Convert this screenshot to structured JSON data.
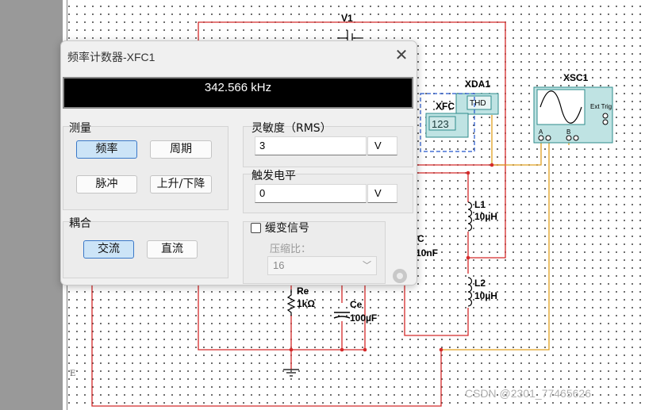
{
  "colors": {
    "wire_red": "#d42a2a",
    "wire_orange": "#e0a020",
    "selection_blue": "#2255cc",
    "instrument_teal": "#2e8b8b"
  },
  "dialog": {
    "title": "频率计数器-XFC1",
    "close_icon": "close-icon",
    "display_value": "342.566 kHz",
    "measure": {
      "label": "测量",
      "buttons": {
        "frequency": "频率",
        "period": "周期",
        "pulse": "脉冲",
        "rise_fall": "上升/下降"
      },
      "active": "frequency"
    },
    "coupling": {
      "label": "耦合",
      "buttons": {
        "ac": "交流",
        "dc": "直流"
      },
      "active": "ac"
    },
    "sensitivity": {
      "label": "灵敏度（RMS）",
      "value": "3",
      "unit": "V"
    },
    "trigger": {
      "label": "触发电平",
      "value": "0",
      "unit": "V"
    },
    "gradual": {
      "label": "缓变信号",
      "checked": false
    },
    "compression": {
      "label": "压缩比：",
      "value": "16"
    }
  },
  "schematic": {
    "v1": "V1",
    "xda1": "XDA1",
    "thd": "THD",
    "xfc": "XFC",
    "xfc_readout": "123",
    "xsc1": "XSC1",
    "ext_trig": "Ext Trig",
    "port_a": "A",
    "port_b": "B",
    "l1_name": "L1",
    "l1_value": "10µH",
    "l2_name": "L2",
    "l2_value": "10µH",
    "c_name": "C",
    "c_value": "10nF",
    "re_name": "Re",
    "re_value": "1kΩ",
    "ce_name": "Ce",
    "ce_value": "100µF",
    "ruler_mark": "E"
  },
  "watermark": "CSDN @2301_77465626"
}
